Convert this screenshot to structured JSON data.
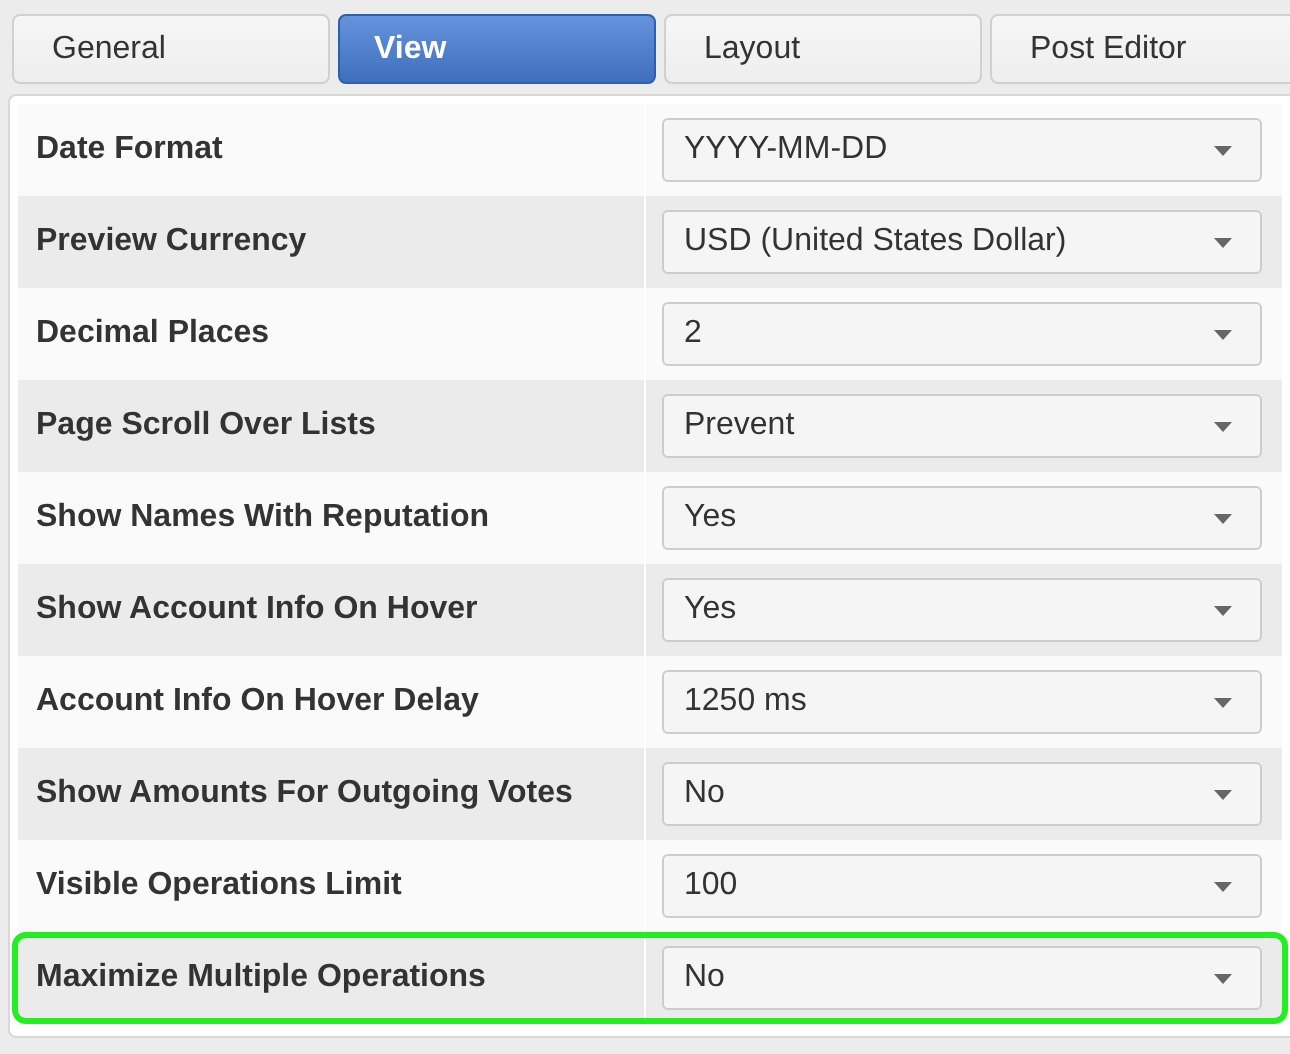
{
  "tabs": [
    {
      "label": "General",
      "selected": false
    },
    {
      "label": "View",
      "selected": true
    },
    {
      "label": "Layout",
      "selected": false
    },
    {
      "label": "Post Editor",
      "selected": false
    }
  ],
  "settings": [
    {
      "label": "Date Format",
      "value": "YYYY-MM-DD",
      "highlighted": false
    },
    {
      "label": "Preview Currency",
      "value": "USD (United States Dollar)",
      "highlighted": false
    },
    {
      "label": "Decimal Places",
      "value": "2",
      "highlighted": false
    },
    {
      "label": "Page Scroll Over Lists",
      "value": "Prevent",
      "highlighted": false
    },
    {
      "label": "Show Names With Reputation",
      "value": "Yes",
      "highlighted": false
    },
    {
      "label": "Show Account Info On Hover",
      "value": "Yes",
      "highlighted": false
    },
    {
      "label": "Account Info On Hover Delay",
      "value": "1250 ms",
      "highlighted": false
    },
    {
      "label": "Show Amounts For Outgoing Votes",
      "value": "No",
      "highlighted": false
    },
    {
      "label": "Visible Operations Limit",
      "value": "100",
      "highlighted": false
    },
    {
      "label": "Maximize Multiple Operations",
      "value": "No",
      "highlighted": true
    }
  ]
}
